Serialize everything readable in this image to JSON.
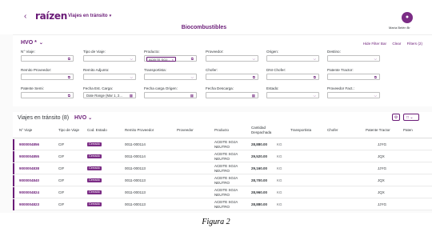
{
  "header": {
    "back_icon": "chevron-left-icon",
    "logo": "raízen",
    "app_title": "Viajes en tránsito",
    "page_title": "Biocombustibles",
    "avatar_icon": "user-icon",
    "user_name": "María Belén Br"
  },
  "filterbar": {
    "variant": "HVO *",
    "links": {
      "hide": "Hide Filter Bar",
      "clear": "Clear",
      "filters": "Filters (2)"
    },
    "fields": [
      {
        "label": "N° Viaje:",
        "value": "",
        "icon": "value-help-icon"
      },
      {
        "label": "Tipo de Viaje:",
        "value": "",
        "icon": "chevron-down-icon"
      },
      {
        "label": "Producto:",
        "value": "ACEITE SOJ...",
        "icon": "value-help-icon"
      },
      {
        "label": "Proveedor:",
        "value": "",
        "icon": "chevron-down-icon"
      },
      {
        "label": "Origen:",
        "value": "",
        "icon": "chevron-down-icon"
      },
      {
        "label": "Destino:",
        "value": "",
        "icon": "chevron-down-icon"
      },
      {
        "label": "Remito Proveedor:",
        "value": "",
        "icon": "value-help-icon"
      },
      {
        "label": "Remito Adjunto:",
        "value": "",
        "icon": "chevron-down-icon"
      },
      {
        "label": "Transportista:",
        "value": "",
        "icon": "chevron-down-icon"
      },
      {
        "label": "Chofer:",
        "value": "",
        "icon": "value-help-icon"
      },
      {
        "label": "DNI Chofer:",
        "value": "",
        "icon": "value-help-icon"
      },
      {
        "label": "Patente Tractor:",
        "value": "",
        "icon": "value-help-icon"
      },
      {
        "label": "Patente Semi:",
        "value": "",
        "icon": "value-help-icon"
      },
      {
        "label": "Fecha Est. Carga:",
        "value": "Date Range (Mar 1, 2...",
        "icon": "calendar-icon"
      },
      {
        "label": "Fecha carga Origen:",
        "value": "",
        "icon": "calendar-icon"
      },
      {
        "label": "Fecha Descarga:",
        "value": "",
        "icon": "calendar-icon"
      },
      {
        "label": "Estado:",
        "value": "",
        "icon": "chevron-down-icon"
      },
      {
        "label": "Proveedor Fact.:",
        "value": "",
        "icon": "chevron-down-icon"
      }
    ]
  },
  "table": {
    "title": "Viajes en tránsito (8)",
    "variant": "HVO",
    "columns": [
      "N° Viaje",
      "Tipo de Viaje",
      "Cod. Estado",
      "Remito Proveedor",
      "Proveedor",
      "Producto",
      "Cantidad Despachada",
      "Transportista",
      "Chofer",
      "Patente Tractor",
      "Paten"
    ],
    "rows": [
      {
        "viaje": "9000004856",
        "tipo": "CIF",
        "estado": "Cerrado",
        "remito": "0011-000114",
        "producto": "ACEITE SOJA NEUTRO",
        "cantidad": "28,880.00",
        "unit": "KG",
        "patente": "JJYG"
      },
      {
        "viaje": "9000004855",
        "tipo": "CIF",
        "estado": "Cerrado",
        "remito": "0011-000114",
        "producto": "ACEITE SOJA NEUTRO",
        "cantidad": "29,520.00",
        "unit": "KG",
        "patente": "JQX"
      },
      {
        "viaje": "9000004838",
        "tipo": "CIF",
        "estado": "Cerrado",
        "remito": "0011-000113",
        "producto": "ACEITE SOJA NEUTRO",
        "cantidad": "29,160.00",
        "unit": "KG",
        "patente": "JJYG"
      },
      {
        "viaje": "9000004840",
        "tipo": "CIF",
        "estado": "Cerrado",
        "remito": "0011-000113",
        "producto": "ACEITE SOJA NEUTRO",
        "cantidad": "28,700.00",
        "unit": "KG",
        "patente": "JQX"
      },
      {
        "viaje": "9000004824",
        "tipo": "CIF",
        "estado": "Cerrado",
        "remito": "0011-000113",
        "producto": "ACEITE SOJA NEUTRO",
        "cantidad": "28,960.00",
        "unit": "KG",
        "patente": "JQX"
      },
      {
        "viaje": "9000004823",
        "tipo": "CIF",
        "estado": "Cerrado",
        "remito": "0011-000113",
        "producto": "ACEITE SOJA NEUTRO",
        "cantidad": "28,880.00",
        "unit": "KG",
        "patente": "JJYG"
      }
    ]
  },
  "caption": "Figura 2",
  "colors": {
    "accent": "#6a1b77",
    "badge": "#7b2c85"
  }
}
